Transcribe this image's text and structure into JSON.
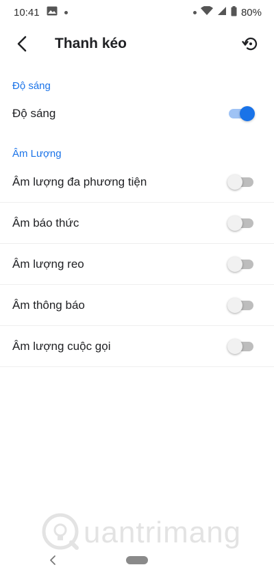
{
  "status_bar": {
    "time": "10:41",
    "battery": "80%",
    "icons": [
      "image-icon",
      "notification-dot-icon",
      "dot-icon",
      "wifi-icon",
      "signal-icon",
      "battery-icon"
    ]
  },
  "app_bar": {
    "title": "Thanh kéo",
    "back_icon": "back-arrow-icon",
    "reset_icon": "restore-icon"
  },
  "sections": {
    "brightness": {
      "header": "Độ sáng",
      "items": [
        {
          "label": "Độ sáng",
          "on": true
        }
      ]
    },
    "volume": {
      "header": "Âm Lượng",
      "items": [
        {
          "label": "Âm lượng đa phương tiện",
          "on": false
        },
        {
          "label": "Âm báo thức",
          "on": false
        },
        {
          "label": "Âm lượng reo",
          "on": false
        },
        {
          "label": "Âm thông báo",
          "on": false
        },
        {
          "label": "Âm lượng cuộc gọi",
          "on": false
        }
      ]
    }
  },
  "watermark": {
    "text": "uantrimang"
  },
  "colors": {
    "accent": "#1a73e8",
    "accent_track": "#9fc3f5",
    "switch_off_track": "#bdbdbd",
    "switch_off_thumb": "#f1f1f1"
  }
}
